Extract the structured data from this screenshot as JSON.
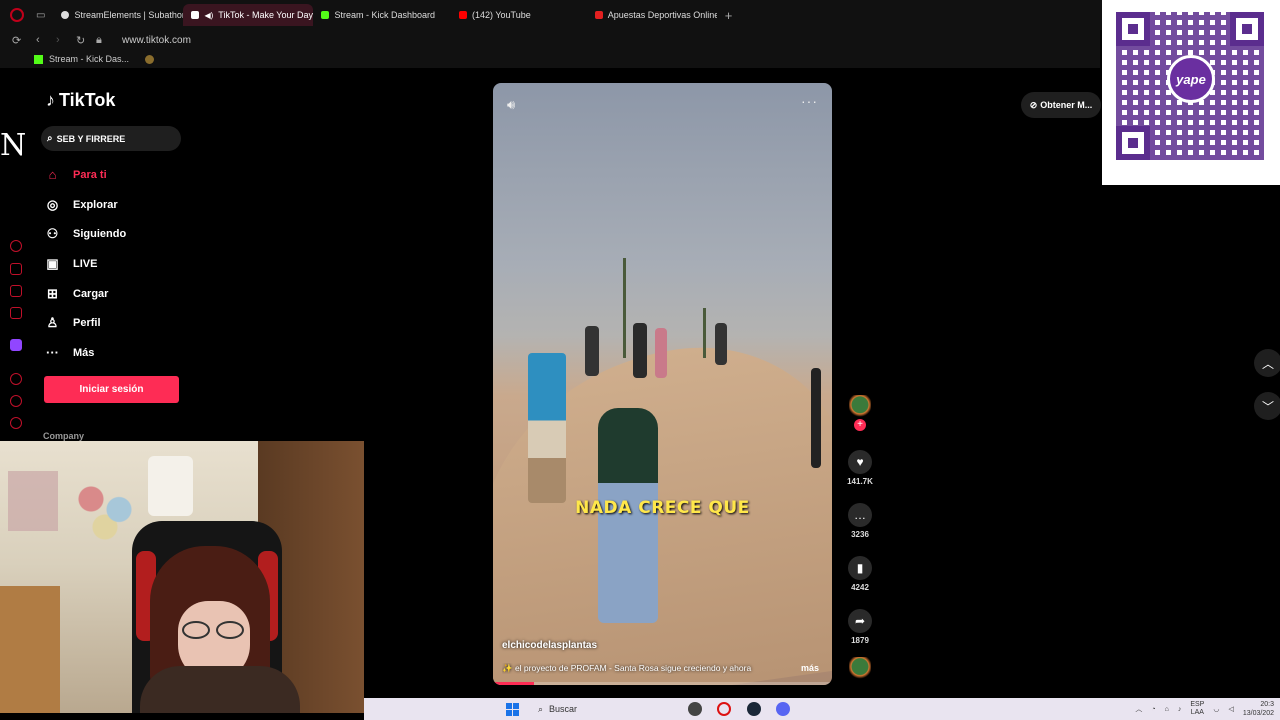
{
  "browser": {
    "tabs": [
      {
        "label": "StreamElements | Subathon",
        "color": "#ffffff",
        "active": false
      },
      {
        "label": "TikTok - Make Your Day",
        "color": "#ffffff",
        "active": true
      },
      {
        "label": "Stream - Kick Dashboard",
        "color": "#53fc18",
        "active": false
      },
      {
        "label": "(142) YouTube",
        "color": "#ff0000",
        "active": false
      },
      {
        "label": "Apuestas Deportivas Online",
        "color": "#e32020",
        "active": false
      }
    ],
    "url": "www.tiktok.com",
    "bookmark": "Stream - Kick Das..."
  },
  "overlay_letter": "N",
  "tiktok": {
    "logo": "TikTok",
    "search_text": "SEB Y FIRRERE",
    "nav": [
      {
        "label": "Para ti",
        "icon": "home-icon"
      },
      {
        "label": "Explorar",
        "icon": "compass-icon"
      },
      {
        "label": "Siguiendo",
        "icon": "following-icon"
      },
      {
        "label": "LIVE",
        "icon": "live-icon"
      },
      {
        "label": "Cargar",
        "icon": "upload-icon"
      },
      {
        "label": "Perfil",
        "icon": "profile-icon"
      },
      {
        "label": "Más",
        "icon": "more-icon"
      }
    ],
    "login": "Iniciar sesión",
    "company": "Company",
    "get_app": "Obtener M...",
    "accent": "#fe2c55"
  },
  "video": {
    "caption": "NADA CRECE QUE",
    "author": "elchicodelasplantas",
    "description": "✨ el proyecto de PROFAM - Santa Rosa sigue creciendo y ahora",
    "more": "más",
    "progress": 0.12
  },
  "actions": {
    "likes": "141.7K",
    "comments": "3236",
    "saves": "4242",
    "shares": "1879"
  },
  "qr": {
    "badge": "yape"
  },
  "taskbar": {
    "search": "Buscar",
    "lang_top": "ESP",
    "lang_bottom": "LAA",
    "time": "20:3",
    "date": "13/03/202"
  }
}
